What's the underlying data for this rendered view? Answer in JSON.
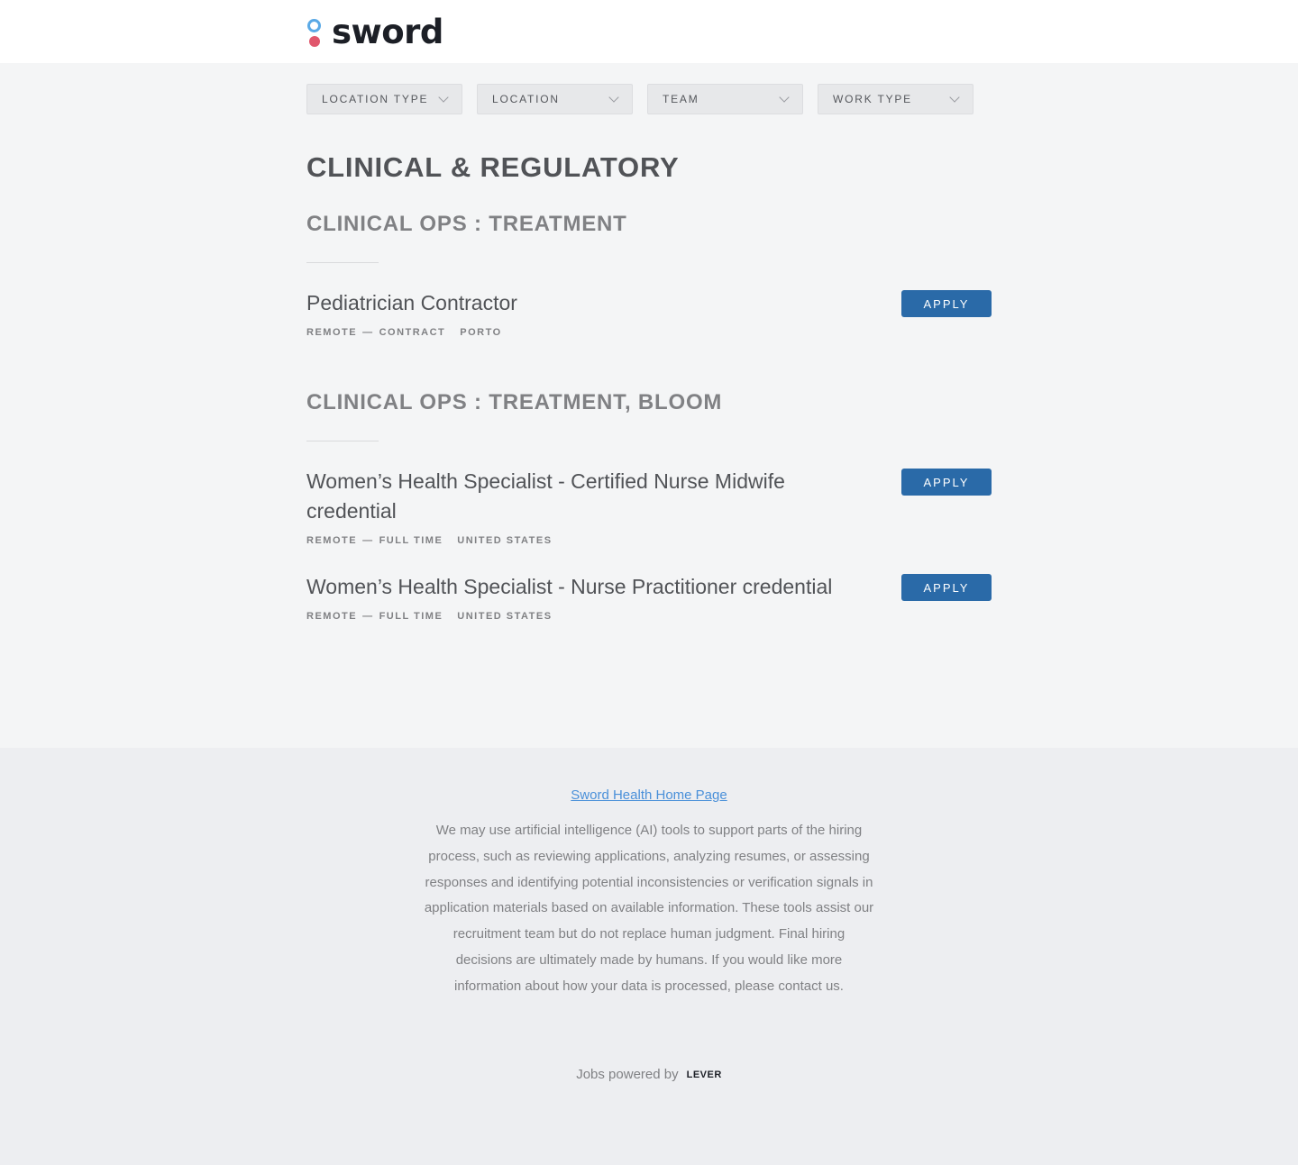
{
  "header": {
    "logo_text": "sword"
  },
  "filters": [
    {
      "label": "LOCATION TYPE"
    },
    {
      "label": "LOCATION"
    },
    {
      "label": "TEAM"
    },
    {
      "label": "WORK TYPE"
    }
  ],
  "department": {
    "title": "CLINICAL & REGULATORY"
  },
  "groups": [
    {
      "title": "CLINICAL OPS : TREATMENT",
      "postings": [
        {
          "title": "Pediatrician Contractor",
          "workplace": "REMOTE",
          "sep": "—",
          "commitment": "CONTRACT",
          "location": "PORTO",
          "apply": "APPLY"
        }
      ]
    },
    {
      "title": "CLINICAL OPS : TREATMENT, BLOOM",
      "postings": [
        {
          "title": "Women’s Health Specialist - Certified Nurse Midwife credential",
          "workplace": "REMOTE",
          "sep": "—",
          "commitment": "FULL TIME",
          "location": "UNITED STATES",
          "apply": "APPLY"
        },
        {
          "title": "Women’s Health Specialist - Nurse Practitioner credential",
          "workplace": "REMOTE",
          "sep": "—",
          "commitment": "FULL TIME",
          "location": "UNITED STATES",
          "apply": "APPLY"
        }
      ]
    }
  ],
  "footer": {
    "home_link": "Sword Health Home Page",
    "disclaimer": "We may use artificial intelligence (AI) tools to support parts of the hiring process, such as reviewing applications, analyzing resumes, or assessing responses and identifying potential inconsistencies or verification signals in application materials based on available information. These tools assist our recruitment team but do not replace human judgment. Final hiring decisions are ultimately made by humans. If you would like more information about how your data is processed, please contact us.",
    "powered_by": "Jobs powered by",
    "lever": "LEVER"
  },
  "colors": {
    "accent": "#2a6aa8",
    "link": "#4a90d9",
    "logo_ring": "#5aa9e6",
    "logo_dot": "#e0566c"
  }
}
